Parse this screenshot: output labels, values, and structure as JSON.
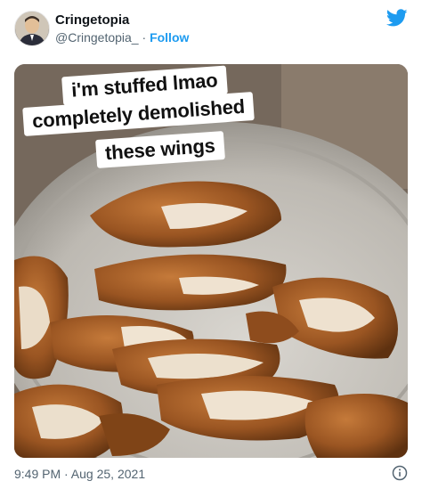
{
  "tweet": {
    "author_name": "Cringetopia",
    "handle": "@Cringetopia_",
    "separator": "·",
    "follow_label": "Follow",
    "timestamp": "9:49 PM · Aug 25, 2021"
  },
  "image": {
    "caption_lines": [
      "i'm stuffed lmao",
      "completely demolished",
      "these wings"
    ]
  },
  "icons": {
    "brand": "twitter-bird-icon",
    "info": "info-icon"
  },
  "colors": {
    "accent": "#1d9bf0",
    "text": "#0f1419",
    "muted": "#536471"
  }
}
